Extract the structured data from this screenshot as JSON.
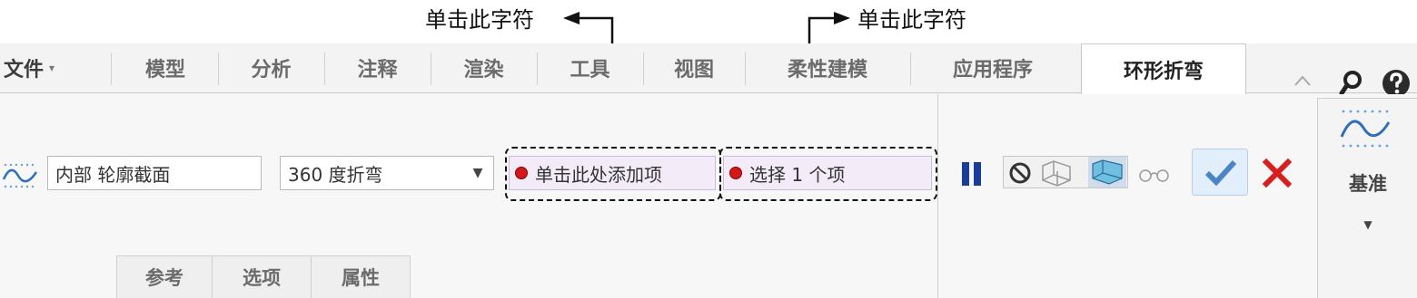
{
  "annotations": {
    "left": "单击此字符",
    "right": "单击此字符"
  },
  "ribbon": {
    "file_label": "文件",
    "tabs": [
      "模型",
      "分析",
      "注释",
      "渲染",
      "工具",
      "视图",
      "柔性建模",
      "应用程序"
    ],
    "active_tab": "环形折弯"
  },
  "dashboard": {
    "type_field": "内部 轮廓截面",
    "bend_select": "360 度折弯",
    "collector1": "单击此处添加项",
    "collector2": "选择 1 个项",
    "datum_label": "基准"
  },
  "subtabs": [
    "参考",
    "选项",
    "属性"
  ],
  "colors": {
    "accent_check": "#4a86c5",
    "cancel": "#d62020",
    "pause": "#1c3c9c",
    "collector_bg": "#f3ecf8"
  }
}
